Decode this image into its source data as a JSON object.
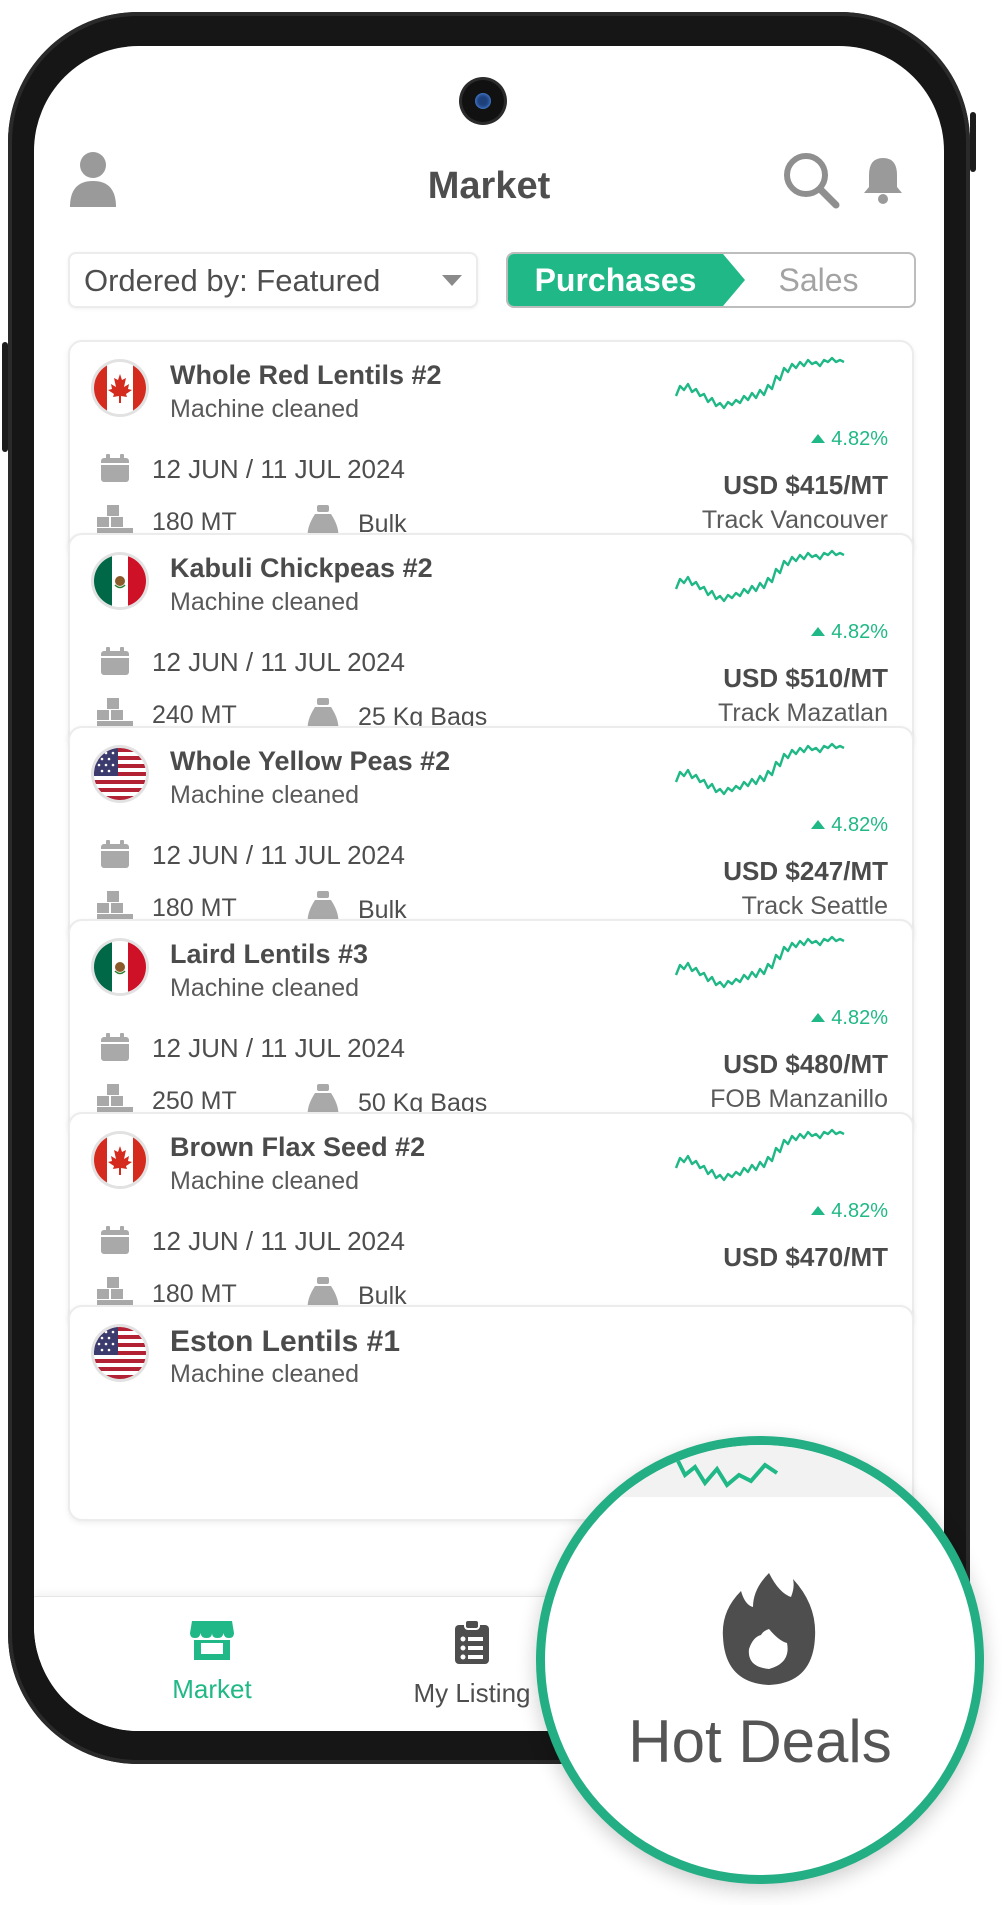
{
  "header": {
    "title": "Market"
  },
  "filters": {
    "sort_label": "Ordered by: Featured",
    "toggle_on": "Purchases",
    "toggle_off": "Sales"
  },
  "colors": {
    "accent": "#20b886",
    "text": "#4b4b4b",
    "muted": "#a3a3a3"
  },
  "listings": [
    {
      "flag": "canada-flag",
      "name": "Whole Red Lentils #2",
      "grade": "Machine cleaned",
      "dates": "12 JUN / 11 JUL 2024",
      "qty": "180 MT",
      "packaging": "Bulk",
      "change": "4.82%",
      "price": "USD $415/MT",
      "location": "Track Vancouver"
    },
    {
      "flag": "mexico-flag",
      "name": "Kabuli Chickpeas #2",
      "grade": "Machine cleaned",
      "dates": "12 JUN / 11 JUL 2024",
      "qty": "240 MT",
      "packaging": "25 Kg Bags",
      "change": "4.82%",
      "price": "USD $510/MT",
      "location": "Track  Mazatlan"
    },
    {
      "flag": "usa-flag",
      "name": "Whole Yellow Peas #2",
      "grade": "Machine cleaned",
      "dates": "12 JUN / 11 JUL 2024",
      "qty": "180 MT",
      "packaging": "Bulk",
      "change": "4.82%",
      "price": "USD $247/MT",
      "location": "Track Seattle"
    },
    {
      "flag": "mexico-flag",
      "name": "Laird Lentils #3",
      "grade": "Machine cleaned",
      "dates": "12 JUN / 11 JUL 2024",
      "qty": "250 MT",
      "packaging": "50 Kg Bags",
      "change": "4.82%",
      "price": "USD $480/MT",
      "location": "FOB Manzanillo"
    },
    {
      "flag": "canada-flag",
      "name": "Brown Flax Seed #2",
      "grade": "Machine cleaned",
      "dates": "12 JUN / 11 JUL 2024",
      "qty": "180 MT",
      "packaging": "Bulk",
      "change": "4.82%",
      "price": "USD $470/MT",
      "location": ""
    },
    {
      "flag": "usa-flag",
      "name": "Eston Lentils #1",
      "grade": "Machine cleaned",
      "dates": "",
      "qty": "",
      "packaging": "",
      "change": "",
      "price": "",
      "location": ""
    }
  ],
  "nav": {
    "market": "Market",
    "listings": "My Listing"
  },
  "callout": {
    "label": "Hot Deals",
    "icon": "fire-icon"
  }
}
